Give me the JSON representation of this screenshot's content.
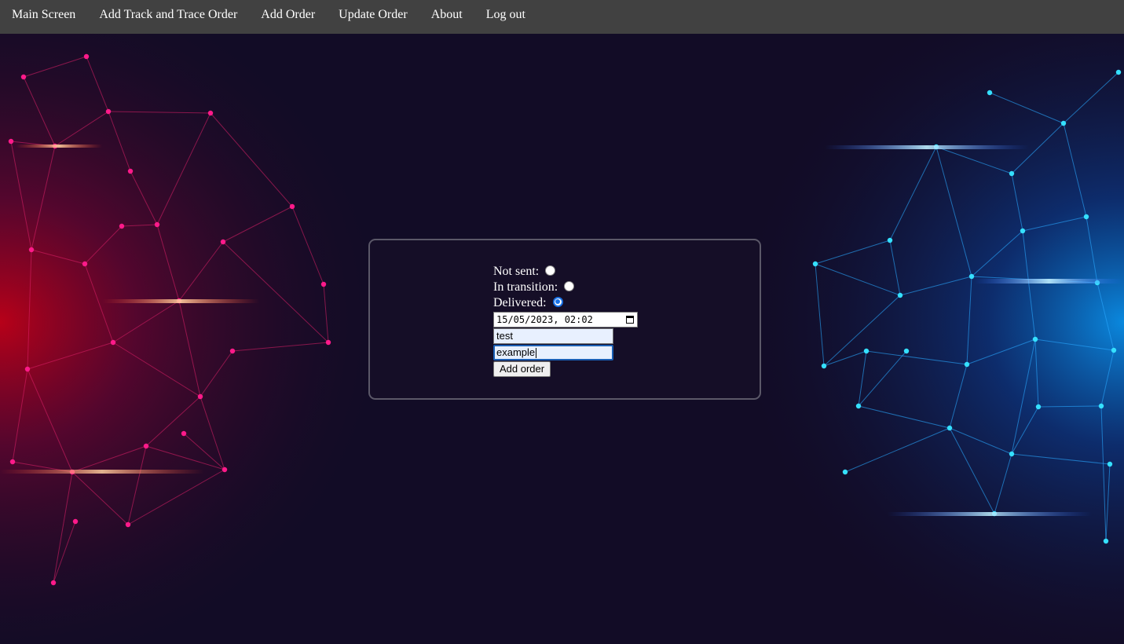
{
  "nav": {
    "items": [
      {
        "label": "Main Screen"
      },
      {
        "label": "Add Track and Trace Order"
      },
      {
        "label": "Add Order"
      },
      {
        "label": "Update Order"
      },
      {
        "label": "About"
      },
      {
        "label": "Log out"
      }
    ],
    "background": "#414141"
  },
  "form": {
    "status_options": [
      {
        "label": "Not sent:",
        "checked": false
      },
      {
        "label": "In transition:",
        "checked": false
      },
      {
        "label": "Delivered:",
        "checked": true
      }
    ],
    "datetime_value": "15/05/2023, 02:02",
    "field1_value": "test",
    "field2_value": "example",
    "submit_label": "Add order"
  },
  "colors": {
    "accent": "#1a73e8",
    "left_glow": "#ff1a3a",
    "right_glow": "#00b7ff",
    "page_bg": "#120c26"
  }
}
